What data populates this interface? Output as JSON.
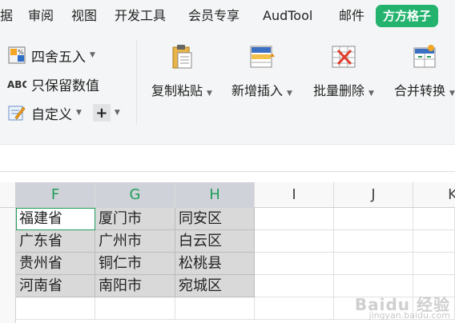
{
  "menu": {
    "items": [
      "据",
      "审阅",
      "视图",
      "开发工具",
      "会员专享",
      "AudTool",
      "邮件"
    ],
    "active_tab": "方方格子"
  },
  "ribbon": {
    "left_group": {
      "round": "四舍五入",
      "keep_values": "只保留数值",
      "custom": "自定义",
      "plus": "+"
    },
    "big_buttons": [
      "复制粘贴",
      "新增插入",
      "批量删除",
      "合并转换"
    ]
  },
  "grid": {
    "columns": [
      "F",
      "G",
      "H",
      "I",
      "J",
      "K"
    ],
    "rows": [
      [
        "福建省",
        "厦门市",
        "同安区"
      ],
      [
        "广东省",
        "广州市",
        "白云区"
      ],
      [
        "贵州省",
        "铜仁市",
        "松桃县"
      ],
      [
        "河南省",
        "南阳市",
        "宛城区"
      ]
    ]
  },
  "watermark": {
    "brand": "Baidu 经验",
    "url": "jingyan.baidu.com"
  },
  "colors": {
    "accent": "#23b36e",
    "selected_header": "#cfd2d8",
    "filled_cell": "#d9d9d9",
    "header_letter": "#1f9e5a"
  }
}
